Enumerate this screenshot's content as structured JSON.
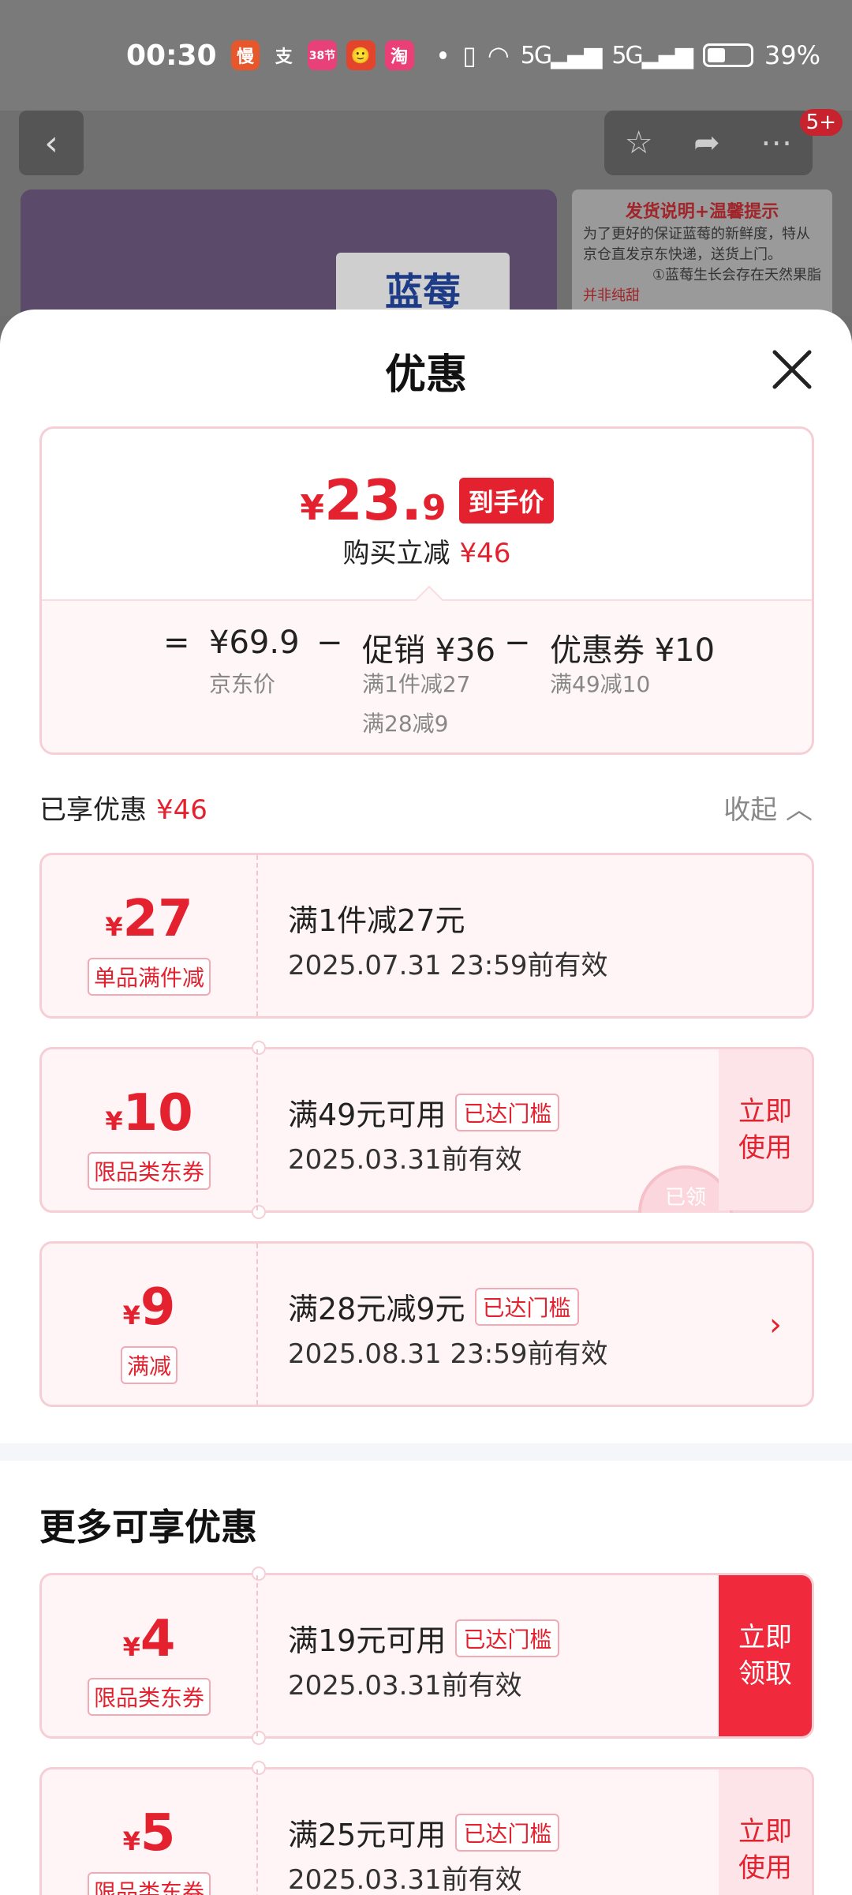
{
  "status": {
    "time": "00:30",
    "apps": [
      "慢",
      "支",
      "38节",
      "🙂",
      "淘"
    ],
    "network": "5G",
    "battery": "39%"
  },
  "background_page": {
    "back_icon": "chevron-left-icon",
    "badge": "5+",
    "banner_title": "发货说明+温馨提示",
    "banner_text": "为了更好的保证蓝莓的新鲜度，特从京仓直发京东快递，送货上门。",
    "banner_note": "①蓝莓生长会存在天然果脂",
    "banner_note2": "并非纯甜",
    "product_label": "蓝莓"
  },
  "sheet": {
    "title": "优惠",
    "summary": {
      "currency": "¥",
      "final_int": "23.",
      "final_dec": "9",
      "final_tag": "到手价",
      "instant_label": "购买立减",
      "instant_amount": "¥46",
      "eq": "=",
      "jd_price": "¥69.9",
      "jd_price_label": "京东价",
      "minus1": "−",
      "promo": "促销 ¥36",
      "promo_sub1": "满1件减27",
      "promo_sub2": "满28减9",
      "minus2": "−",
      "coupon": "优惠券 ¥10",
      "coupon_sub": "满49减10"
    },
    "enjoyed_label": "已享优惠",
    "enjoyed_amount": "¥46",
    "collapse_label": "收起 ︿",
    "coupons": [
      {
        "cur": "¥",
        "amount": "27",
        "type": "单品满件减",
        "main": "满1件减27元",
        "date": "2025.07.31 23:59前有效"
      },
      {
        "cur": "¥",
        "amount": "10",
        "type": "限品类东券",
        "main": "满49元可用",
        "reach": "已达门槛",
        "date": "2025.03.31前有效",
        "action": "立即\n使用",
        "stamp": "已领"
      },
      {
        "cur": "¥",
        "amount": "9",
        "type": "满减",
        "main": "满28元减9元",
        "reach": "已达门槛",
        "date": "2025.08.31 23:59前有效",
        "chevron": "›"
      }
    ],
    "more_title": "更多可享优惠",
    "more_coupons": [
      {
        "cur": "¥",
        "amount": "4",
        "type": "限品类东券",
        "main": "满19元可用",
        "reach": "已达门槛",
        "date": "2025.03.31前有效",
        "action": "立即\n领取"
      },
      {
        "cur": "¥",
        "amount": "5",
        "type": "限品类东券",
        "main": "满25元可用",
        "reach": "已达门槛",
        "date": "2025.03.31前有效",
        "action": "立即\n使用"
      }
    ]
  },
  "colors": {
    "accent": "#e4222f",
    "pale": "#fff5f6",
    "border": "#f6cfd6"
  }
}
